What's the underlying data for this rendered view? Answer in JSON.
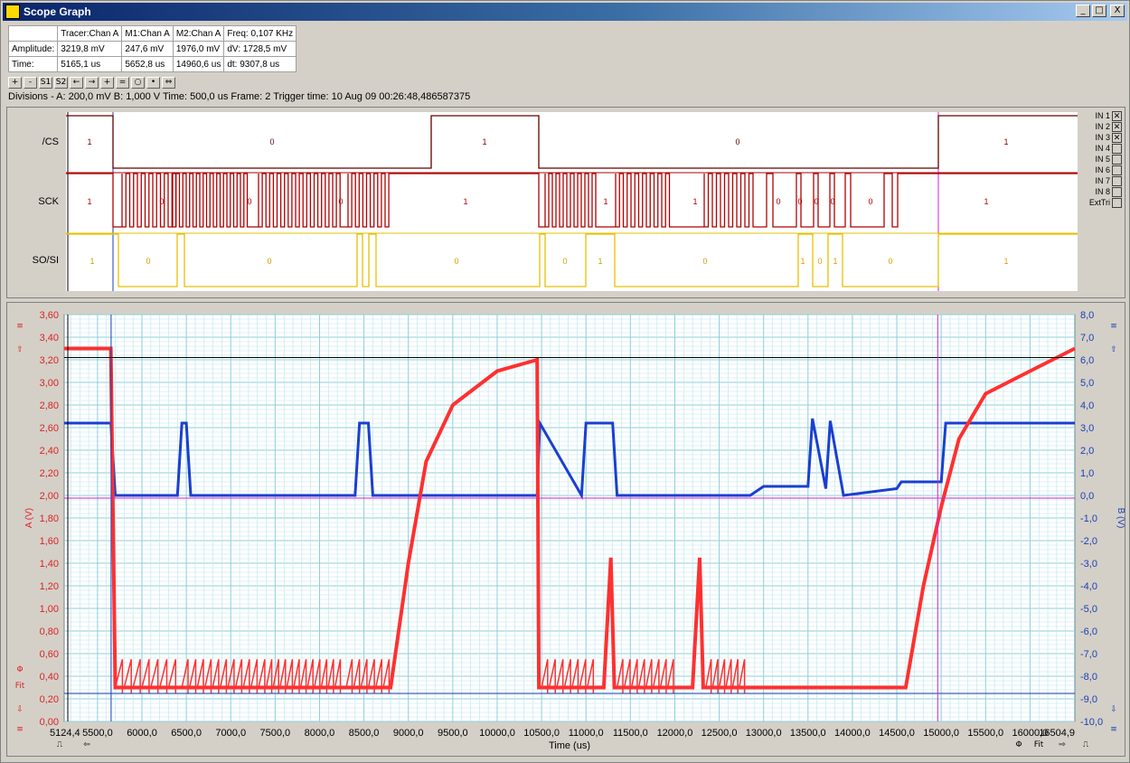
{
  "window": {
    "title": "Scope Graph",
    "minimize": "_",
    "maximize": "□",
    "close": "X"
  },
  "measurements": {
    "headers": [
      "",
      "Tracer:Chan A",
      "M1:Chan A",
      "M2:Chan A",
      "Freq: 0,107 KHz"
    ],
    "rows": [
      [
        "Amplitude:",
        "3219,8 mV",
        "247,6 mV",
        "1976,0 mV",
        "dV: 1728,5 mV"
      ],
      [
        "Time:",
        "5165,1 us",
        "5652,8 us",
        "14960,6 us",
        "dt:  9307,8 us"
      ]
    ]
  },
  "toolbar": {
    "buttons": [
      {
        "name": "zoom-in-button",
        "label": "+"
      },
      {
        "name": "zoom-out-button",
        "label": "-"
      },
      {
        "name": "s1-button",
        "label": "S1"
      },
      {
        "name": "s2-button",
        "label": "S2"
      },
      {
        "name": "arrow-left-button",
        "label": "←"
      },
      {
        "name": "arrow-right-button",
        "label": "→"
      },
      {
        "name": "cursor-cross-button",
        "label": "+"
      },
      {
        "name": "cursor-h-button",
        "label": "="
      },
      {
        "name": "camera-button",
        "label": "○"
      },
      {
        "name": "marker-button",
        "label": "•"
      },
      {
        "name": "expand-button",
        "label": "⇔"
      }
    ]
  },
  "divisions": "Divisions -   A: 200,0 mV   B: 1,000 V   Time: 500,0 us  Frame: 2       Trigger time: 10 Aug 09 00:26:48,486587375",
  "logic": {
    "channels": [
      "/CS",
      "SCK",
      "SO/SI"
    ],
    "cs_labels": [
      "1",
      "0",
      "1",
      "0",
      "1"
    ],
    "sck_labels": [
      "1",
      "0",
      "0",
      "0",
      "1",
      "1",
      "1",
      "0",
      "0",
      "0",
      "0",
      "0",
      "1"
    ],
    "sosi_labels": [
      "1",
      "0",
      "0",
      "0",
      "0",
      "1",
      "0",
      "1",
      "0",
      "1",
      "0",
      "1"
    ],
    "inputs": [
      {
        "label": "IN 1",
        "checked": "☒"
      },
      {
        "label": "IN 2",
        "checked": "☒"
      },
      {
        "label": "IN 3",
        "checked": "☒"
      },
      {
        "label": "IN 4",
        "checked": ""
      },
      {
        "label": "IN 5",
        "checked": ""
      },
      {
        "label": "IN 6",
        "checked": ""
      },
      {
        "label": "IN 7",
        "checked": ""
      },
      {
        "label": "IN 8",
        "checked": ""
      },
      {
        "label": "ExtTri",
        "checked": ""
      }
    ]
  },
  "analog": {
    "left_axis_title": "A (V)",
    "right_axis_title": "B (V)",
    "x_axis_title": "Time (us)",
    "left_ticks": [
      "3,60",
      "3,40",
      "3,20",
      "3,00",
      "2,80",
      "2,60",
      "2,40",
      "2,20",
      "2,00",
      "1,80",
      "1,60",
      "1,40",
      "1,20",
      "1,00",
      "0,80",
      "0,60",
      "0,40",
      "0,20",
      "0,00"
    ],
    "right_ticks": [
      "8,0",
      "7,0",
      "6,0",
      "5,0",
      "4,0",
      "3,0",
      "2,0",
      "1,0",
      "0,0",
      "-1,0",
      "-2,0",
      "-3,0",
      "-4,0",
      "-5,0",
      "-6,0",
      "-7,0",
      "-8,0",
      "-9,0",
      "-10,0"
    ],
    "x_ticks": [
      "5124,4",
      "5500,0",
      "6000,0",
      "6500,0",
      "7000,0",
      "7500,0",
      "8000,0",
      "8500,0",
      "9000,0",
      "9500,0",
      "10000,0",
      "10500,0",
      "11000,0",
      "11500,0",
      "12000,0",
      "12500,0",
      "13000,0",
      "13500,0",
      "14000,0",
      "14500,0",
      "15000,0",
      "15500,0",
      "16000,0",
      "16504,9"
    ],
    "colors": {
      "a": "#ff3030",
      "b": "#1a3fd0",
      "grid": "#bde5ea"
    },
    "side_left": [
      "≡",
      "⇧",
      "Φ",
      "Fit",
      "⇩",
      "≡"
    ],
    "side_right": [
      "≡",
      "⇧",
      "⇩",
      "≡"
    ],
    "bottom_left": [
      "⎍",
      "⇦"
    ],
    "bottom_right": [
      "Φ",
      "Fit",
      "⇨",
      "⎍"
    ]
  },
  "chart_data": {
    "type": "line",
    "xlabel": "Time (us)",
    "ylabel": "A (V)",
    "y2label": "B (V)",
    "xlim": [
      5124.4,
      16504.9
    ],
    "ylim": [
      0,
      3.6
    ],
    "y2lim": [
      -10,
      8
    ],
    "series": [
      {
        "axis": "A",
        "x": [
          5124.4,
          5650,
          5700,
          8500,
          8800,
          9000,
          9200,
          9500,
          10000,
          10450,
          10470,
          10500,
          11200,
          11280,
          11320,
          12200,
          12280,
          12320,
          12800,
          12850,
          14500,
          14600,
          14800,
          15000,
          15200,
          15500,
          16000,
          16504.9
        ],
        "y": [
          3.3,
          3.3,
          0.3,
          0.3,
          0.3,
          1.4,
          2.3,
          2.8,
          3.1,
          3.2,
          0.3,
          0.3,
          0.3,
          1.45,
          0.3,
          0.3,
          1.45,
          0.3,
          0.3,
          0.3,
          0.3,
          0.3,
          1.2,
          1.9,
          2.5,
          2.9,
          3.1,
          3.3
        ]
      },
      {
        "axis": "B",
        "x": [
          5124.4,
          5650,
          5700,
          6400,
          6450,
          6500,
          6550,
          8400,
          8450,
          8550,
          8600,
          10450,
          10480,
          10950,
          11000,
          11300,
          11350,
          12850,
          13000,
          13500,
          13550,
          13700,
          13750,
          13900,
          14500,
          14550,
          15000,
          15050,
          16504.9
        ],
        "y": [
          3.2,
          3.2,
          0.0,
          0.0,
          3.2,
          3.2,
          0.0,
          0.0,
          3.2,
          3.2,
          0.0,
          0.0,
          3.2,
          0.0,
          3.2,
          3.2,
          0.0,
          0.0,
          0.4,
          0.4,
          3.4,
          0.3,
          3.3,
          0.0,
          0.3,
          0.6,
          0.6,
          3.2,
          3.2
        ]
      }
    ]
  }
}
